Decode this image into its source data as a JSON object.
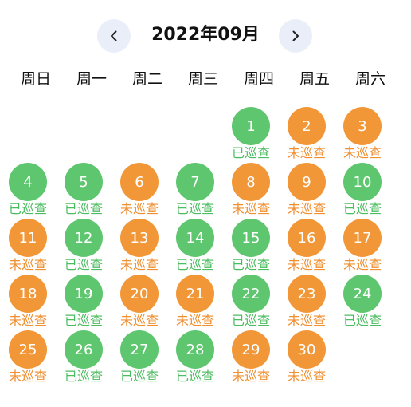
{
  "header": {
    "title": "2022年09月"
  },
  "weekdays": [
    "周日",
    "周一",
    "周二",
    "周三",
    "周四",
    "周五",
    "周六"
  ],
  "status_labels": {
    "done": "已巡查",
    "todo": "未巡查"
  },
  "colors": {
    "done": "#5ec66e",
    "todo": "#f29738",
    "nav_bg": "#e9eef8"
  },
  "first_weekday": 4,
  "days": [
    {
      "day": "1",
      "status": "done"
    },
    {
      "day": "2",
      "status": "todo"
    },
    {
      "day": "3",
      "status": "todo"
    },
    {
      "day": "4",
      "status": "done"
    },
    {
      "day": "5",
      "status": "done"
    },
    {
      "day": "6",
      "status": "todo"
    },
    {
      "day": "7",
      "status": "done"
    },
    {
      "day": "8",
      "status": "todo"
    },
    {
      "day": "9",
      "status": "todo"
    },
    {
      "day": "10",
      "status": "done"
    },
    {
      "day": "11",
      "status": "todo"
    },
    {
      "day": "12",
      "status": "done"
    },
    {
      "day": "13",
      "status": "todo"
    },
    {
      "day": "14",
      "status": "done"
    },
    {
      "day": "15",
      "status": "done"
    },
    {
      "day": "16",
      "status": "todo"
    },
    {
      "day": "17",
      "status": "todo"
    },
    {
      "day": "18",
      "status": "todo"
    },
    {
      "day": "19",
      "status": "done"
    },
    {
      "day": "20",
      "status": "todo"
    },
    {
      "day": "21",
      "status": "todo"
    },
    {
      "day": "22",
      "status": "done"
    },
    {
      "day": "23",
      "status": "todo"
    },
    {
      "day": "24",
      "status": "done"
    },
    {
      "day": "25",
      "status": "todo"
    },
    {
      "day": "26",
      "status": "done"
    },
    {
      "day": "27",
      "status": "done"
    },
    {
      "day": "28",
      "status": "done"
    },
    {
      "day": "29",
      "status": "todo"
    },
    {
      "day": "30",
      "status": "todo"
    }
  ]
}
